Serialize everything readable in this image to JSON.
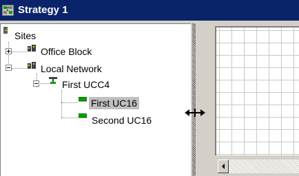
{
  "window": {
    "title": "Strategy 1"
  },
  "tree": {
    "root": {
      "label": "Sites",
      "icon": "sites-icon"
    },
    "items": [
      {
        "label": "Office Block",
        "icon": "building-icon",
        "expander": "plus"
      },
      {
        "label": "Local Network",
        "icon": "building-icon",
        "expander": "minus"
      },
      {
        "label": "First UCC4",
        "icon": "controller-icon",
        "expander": "minus"
      },
      {
        "label": "First UC16",
        "icon": "unit-icon",
        "selected": true
      },
      {
        "label": "Second UC16",
        "icon": "unit-icon"
      }
    ]
  },
  "cursor": {
    "icon": "resize-horizontal-icon"
  },
  "colors": {
    "titlebar": "#0a246a",
    "selection": "#c0c0c0",
    "unit_green": "#00a000"
  }
}
